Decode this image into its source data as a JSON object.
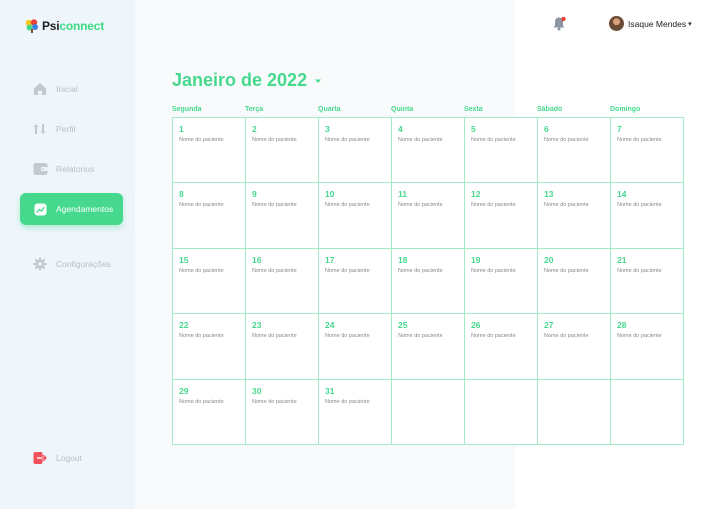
{
  "brand": {
    "part1": "Psi",
    "part2": "connect"
  },
  "sidebar": {
    "items": [
      {
        "label": "Inicial",
        "icon": "home-icon"
      },
      {
        "label": "Perfil",
        "icon": "sort-icon"
      },
      {
        "label": "Relatorios",
        "icon": "wallet-icon"
      },
      {
        "label": "Agendamentos",
        "icon": "chart-icon",
        "active": true
      },
      {
        "label": "Configurações",
        "icon": "gear-icon"
      }
    ],
    "logout": {
      "label": "Logout",
      "icon": "logout-icon"
    }
  },
  "header": {
    "user_name": "Isaque Mendes",
    "caret": "▾",
    "notification_icon": "bell-icon"
  },
  "calendar": {
    "title": "Janeiro de 2022",
    "weekdays": [
      "Segunda",
      "Terça",
      "Quarta",
      "Quinta",
      "Sexta",
      "Sábado",
      "Domingo"
    ],
    "weeks": [
      [
        {
          "day": "1",
          "patient": "Nome do paciente"
        },
        {
          "day": "2",
          "patient": "Nome do paciente"
        },
        {
          "day": "3",
          "patient": "Nome do paciente"
        },
        {
          "day": "4",
          "patient": "Nome do paciente"
        },
        {
          "day": "5",
          "patient": "Nome do paciente"
        },
        {
          "day": "6",
          "patient": "Nome do paciente"
        },
        {
          "day": "7",
          "patient": "Nome do paciente"
        }
      ],
      [
        {
          "day": "8",
          "patient": "Nome do paciente"
        },
        {
          "day": "9",
          "patient": "Nome do paciente"
        },
        {
          "day": "10",
          "patient": "Nome do paciente"
        },
        {
          "day": "11",
          "patient": "Nome do paciente"
        },
        {
          "day": "12",
          "patient": "Nome do paciente"
        },
        {
          "day": "13",
          "patient": "Nome do paciente"
        },
        {
          "day": "14",
          "patient": "Nome do paciente"
        }
      ],
      [
        {
          "day": "15",
          "patient": "Nome do paciente"
        },
        {
          "day": "16",
          "patient": "Nome do paciente"
        },
        {
          "day": "17",
          "patient": "Nome do paciente"
        },
        {
          "day": "18",
          "patient": "Nome do paciente"
        },
        {
          "day": "19",
          "patient": "Nome do paciente"
        },
        {
          "day": "20",
          "patient": "Nome do paciente"
        },
        {
          "day": "21",
          "patient": "Nome do paciente"
        }
      ],
      [
        {
          "day": "22",
          "patient": "Nome do paciente"
        },
        {
          "day": "23",
          "patient": "Nome do paciente"
        },
        {
          "day": "24",
          "patient": "Nome do paciente"
        },
        {
          "day": "25",
          "patient": "Nome do paciente"
        },
        {
          "day": "26",
          "patient": "Nome do paciente"
        },
        {
          "day": "27",
          "patient": "Nome do paciente"
        },
        {
          "day": "28",
          "patient": "Nome do paciente"
        }
      ],
      [
        {
          "day": "29",
          "patient": "Nome do paciente"
        },
        {
          "day": "30",
          "patient": "Nome do paciente"
        },
        {
          "day": "31",
          "patient": "Nome do paciente"
        },
        {
          "day": "",
          "patient": ""
        },
        {
          "day": "",
          "patient": ""
        },
        {
          "day": "",
          "patient": ""
        },
        {
          "day": "",
          "patient": ""
        }
      ]
    ]
  },
  "colors": {
    "accent": "#46d98e",
    "sidebar_bg": "#eef5fb",
    "muted_text": "#b8bec6",
    "grid_line": "#a5ebc6",
    "logout_red": "#f0505a"
  }
}
